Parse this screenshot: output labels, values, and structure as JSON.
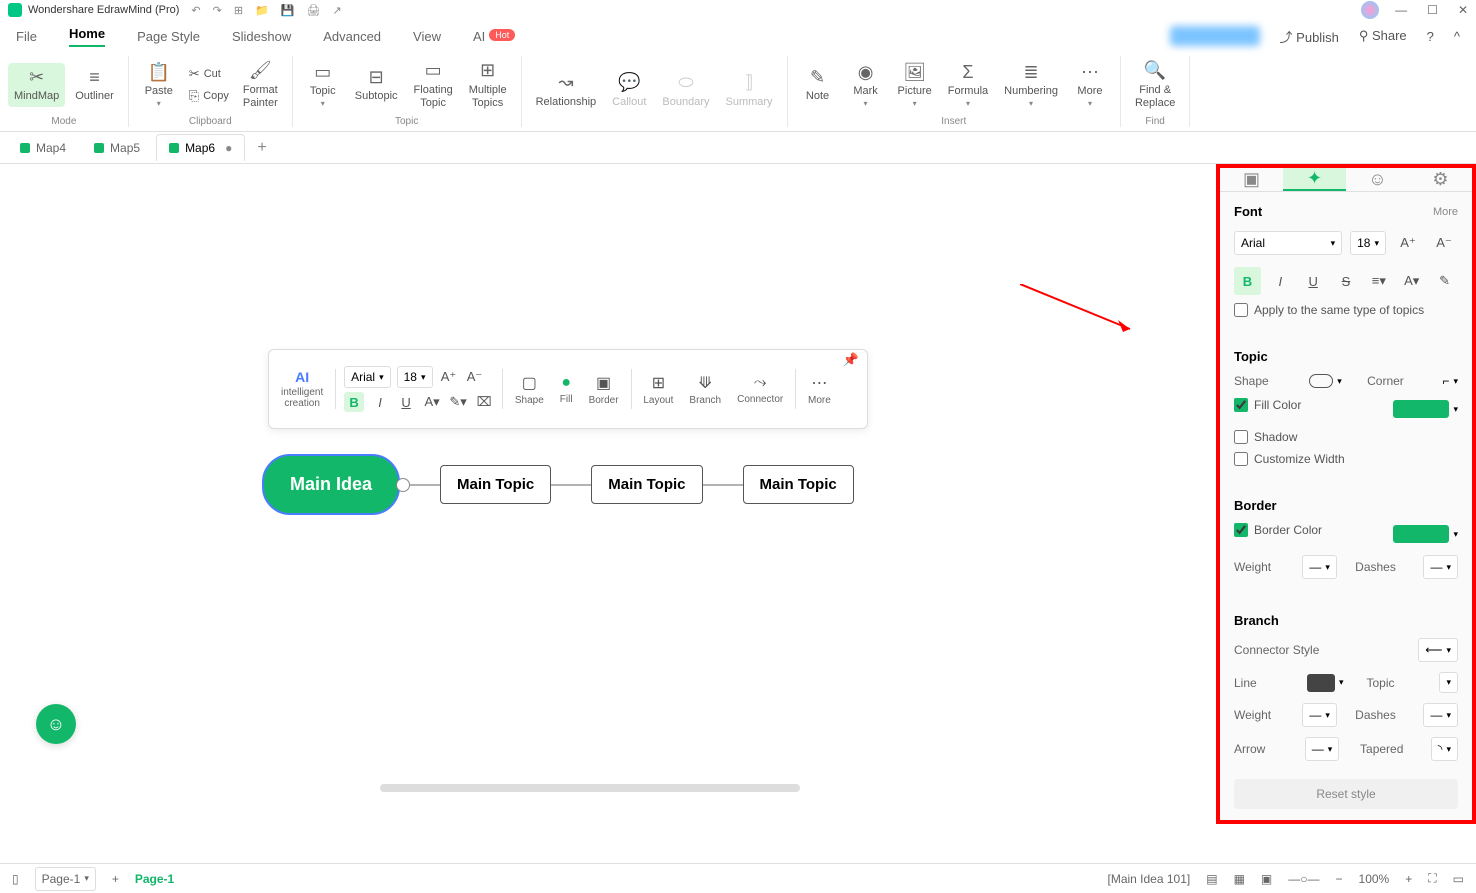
{
  "app": {
    "title": "Wondershare EdrawMind (Pro)"
  },
  "menubar": {
    "items": [
      "File",
      "Home",
      "Page Style",
      "Slideshow",
      "Advanced",
      "View",
      "AI"
    ],
    "ai_badge": "Hot",
    "publish": "Publish",
    "share": "Share"
  },
  "ribbon": {
    "mode": {
      "mindmap": "MindMap",
      "outliner": "Outliner",
      "label": "Mode"
    },
    "clipboard": {
      "paste": "Paste",
      "cut": "Cut",
      "copy": "Copy",
      "format_painter": "Format\nPainter",
      "label": "Clipboard"
    },
    "topic": {
      "topic": "Topic",
      "subtopic": "Subtopic",
      "floating": "Floating\nTopic",
      "multiple": "Multiple\nTopics",
      "label": "Topic"
    },
    "relationship": "Relationship",
    "callout": "Callout",
    "boundary": "Boundary",
    "summary": "Summary",
    "insert": {
      "note": "Note",
      "mark": "Mark",
      "picture": "Picture",
      "formula": "Formula",
      "numbering": "Numbering",
      "more": "More",
      "label": "Insert"
    },
    "find": {
      "find_replace": "Find &\nReplace",
      "label": "Find"
    }
  },
  "tabs": [
    {
      "name": "Map4",
      "active": false,
      "dirty": false
    },
    {
      "name": "Map5",
      "active": false,
      "dirty": false
    },
    {
      "name": "Map6",
      "active": true,
      "dirty": true
    }
  ],
  "float_toolbar": {
    "ai": "AI",
    "ai_label": "intelligent\ncreation",
    "font": "Arial",
    "size": "18",
    "shape": "Shape",
    "fill": "Fill",
    "border": "Border",
    "layout": "Layout",
    "branch": "Branch",
    "connector": "Connector",
    "more": "More"
  },
  "mindmap": {
    "main": "Main Idea",
    "topics": [
      "Main Topic",
      "Main Topic",
      "Main Topic"
    ]
  },
  "panel": {
    "font": {
      "title": "Font",
      "more": "More",
      "family": "Arial",
      "size": "18",
      "apply_same": "Apply to the same type of topics"
    },
    "topic": {
      "title": "Topic",
      "shape": "Shape",
      "corner": "Corner",
      "fill_color": "Fill Color",
      "shadow": "Shadow",
      "customize_width": "Customize Width"
    },
    "border": {
      "title": "Border",
      "border_color": "Border Color",
      "weight": "Weight",
      "dashes": "Dashes"
    },
    "branch": {
      "title": "Branch",
      "connector_style": "Connector Style",
      "line": "Line",
      "topic": "Topic",
      "weight": "Weight",
      "dashes": "Dashes",
      "arrow": "Arrow",
      "tapered": "Tapered"
    },
    "reset": "Reset style"
  },
  "statusbar": {
    "page_select": "Page-1",
    "page_active": "Page-1",
    "selection": "[Main Idea 101]",
    "zoom": "100%"
  }
}
